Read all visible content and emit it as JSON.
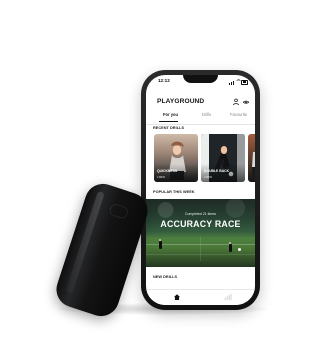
{
  "status_bar": {
    "time": "12:12"
  },
  "app": {
    "title": "PLAYGROUND"
  },
  "tabs": [
    {
      "label": "For you"
    },
    {
      "label": "Drills"
    },
    {
      "label": "Favourite"
    }
  ],
  "sections": {
    "recent": "RECENT DRILLS",
    "popular": "POPULAR THIS WEEK",
    "new": "NEW DRILLS"
  },
  "recent_drills": [
    {
      "name": "QUICKNESS",
      "meta": "2 MINS"
    },
    {
      "name": "DOUBLE BACK",
      "meta": "2 MINS"
    }
  ],
  "hero": {
    "kicker": "Completed 21 times",
    "title": "ACCURACY RACE"
  },
  "icons": {
    "profile": "profile-icon",
    "settings": "settings-icon",
    "home": "home-icon",
    "stats": "stats-icon"
  },
  "colors": {
    "device_black": "#111112",
    "accent_text": "#161616",
    "field_green": "#4d803f"
  }
}
